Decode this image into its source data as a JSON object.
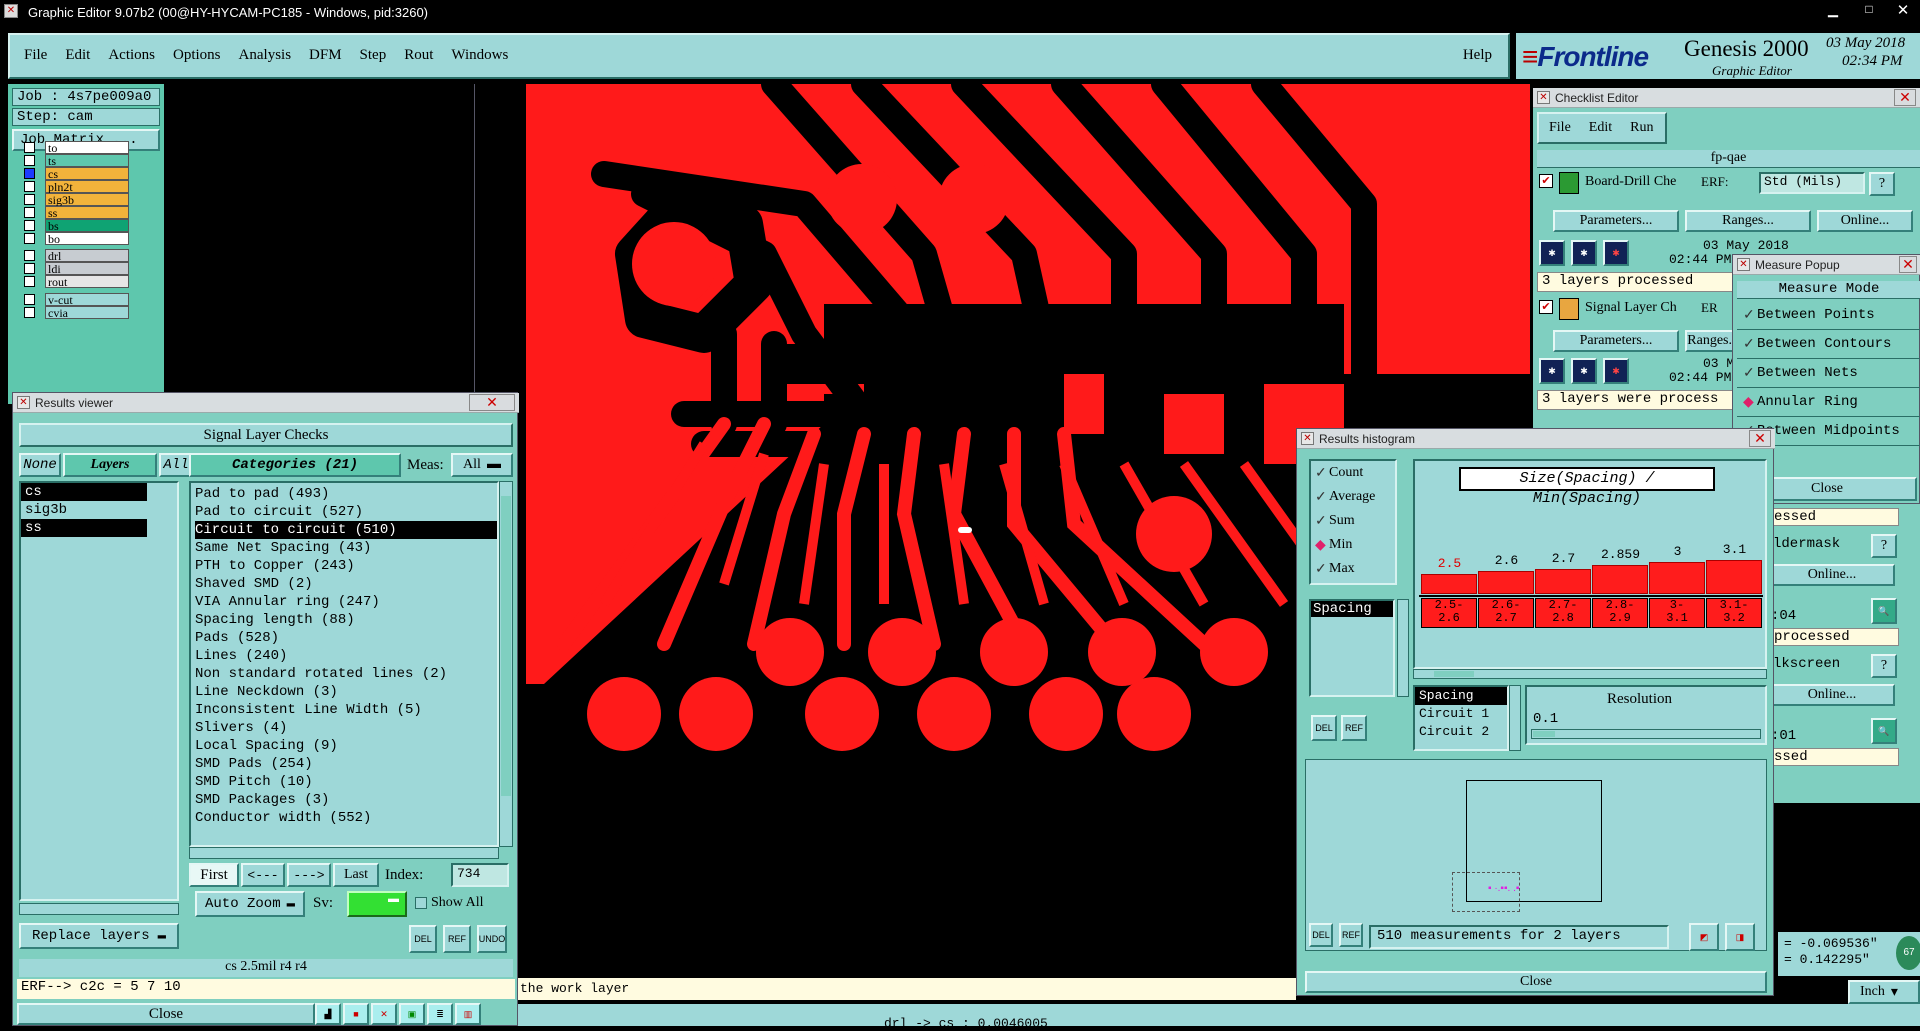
{
  "window": {
    "title": "Graphic Editor 9.07b2 (00@HY-HYCAM-PC185 - Windows, pid:3260)"
  },
  "menu": [
    "File",
    "Edit",
    "Actions",
    "Options",
    "Analysis",
    "DFM",
    "Step",
    "Rout",
    "Windows"
  ],
  "help": "Help",
  "brand": {
    "logo": "Frontline",
    "product": "Genesis 2000",
    "subtitle": "Graphic Editor",
    "date": "03 May 2018",
    "time": "02:34 PM"
  },
  "job": {
    "job": "Job : 4s7pe009a0",
    "step": "Step: cam",
    "matrix": "Job Matrix ..."
  },
  "layers": [
    {
      "name": "to",
      "color": "#ffffff"
    },
    {
      "name": "ts",
      "color": "#5ec7ad"
    },
    {
      "name": "cs",
      "color": "#f2b33b"
    },
    {
      "name": "pln2t",
      "color": "#f2b33b"
    },
    {
      "name": "sig3b",
      "color": "#f2b33b"
    },
    {
      "name": "ss",
      "color": "#f2b33b"
    },
    {
      "name": "bs",
      "color": "#0fa373"
    },
    {
      "name": "bo",
      "color": "#ffffff"
    },
    {
      "name": "drl",
      "color": "#c7ccd1"
    },
    {
      "name": "ldi",
      "color": "#c7ccd1"
    },
    {
      "name": "rout",
      "color": "#e6e6e6"
    },
    {
      "name": "v-cut",
      "color": "#9ed8d8"
    },
    {
      "name": "cvia",
      "color": "#9ed8d8"
    }
  ],
  "results": {
    "title": "Results viewer",
    "header": "Signal Layer Checks",
    "none": "None",
    "layers_btn": "Layers",
    "all": "All",
    "layer_list": [
      "cs",
      "sig3b",
      "ss"
    ],
    "categories_btn": "Categories (21)",
    "meas_label": "Meas:",
    "meas_value": "All",
    "categories": [
      "Pad to pad (493)",
      "Pad to circuit (527)",
      "Circuit to circuit (510)",
      "Same Net Spacing (43)",
      "PTH to Copper (243)",
      "Shaved SMD (2)",
      "VIA Annular ring (247)",
      "Spacing length (88)",
      "Pads (528)",
      "Lines (240)",
      "Non standard rotated lines (2)",
      "Line Neckdown (3)",
      "Inconsistent Line Width (5)",
      "Slivers (4)",
      "Local Spacing (9)",
      "SMD Pads (254)",
      "SMD Pitch (10)",
      "SMD Packages (3)",
      "Conductor width (552)"
    ],
    "first": "First",
    "prev": "<---",
    "next": "--->",
    "last": "Last",
    "index_label": "Index:",
    "index_value": "734",
    "autozoom": "Auto Zoom",
    "sv": "Sv:",
    "showall": "Show All",
    "replace": "Replace layers",
    "status": "cs 2.5mil  r4  r4",
    "erf": "ERF--> c2c = 5 7 10",
    "close": "Close",
    "del": "DEL",
    "ref": "REF",
    "undo": "UNDO"
  },
  "checklist": {
    "title": "Checklist Editor",
    "menu": [
      "File",
      "Edit",
      "Run"
    ],
    "name": "fp-qae",
    "row1": {
      "name": "Board-Drill Che",
      "erf": "ERF:",
      "std": "Std (Mils)",
      "date": "03 May 2018",
      "time": "02:44 PM",
      "status": "3 layers processed"
    },
    "row2": {
      "name": "Signal Layer Ch",
      "erf": "ER",
      "date": "03 May",
      "time": "02:44 PM",
      "status": "3 layers were process"
    },
    "params": "Parameters...",
    "ranges": "Ranges...",
    "online": "Online...",
    "q": "?",
    "frag": [
      "essed",
      "ldermask",
      "Online...",
      ":04",
      "processed",
      "lkscreen",
      "Online...",
      ":01",
      "ssed"
    ]
  },
  "measure": {
    "title": "Measure Popup",
    "header": "Measure Mode",
    "modes": [
      "Between Points",
      "Between Contours",
      "Between Nets",
      "Annular Ring",
      "Between Midpoints"
    ],
    "close": "Close"
  },
  "histogram": {
    "title": "Results histogram",
    "stats": [
      "Count",
      "Average",
      "Sum",
      "Min",
      "Max"
    ],
    "selected_stat": "Min",
    "spacing": "Spacing",
    "chart_title": "Size(Spacing) / Min(Spacing)",
    "list": [
      "Spacing",
      "Circuit 1",
      "Circuit 2"
    ],
    "resolution_label": "Resolution",
    "resolution_value": "0.1",
    "status": "510 measurements for 2 layers",
    "close": "Close",
    "del": "DEL",
    "ref": "REF"
  },
  "chart_data": {
    "type": "bar",
    "title": "Size(Spacing) / Min(Spacing)",
    "categories": [
      "2.5-\n2.6",
      "2.6-\n2.7",
      "2.7-\n2.8",
      "2.8-\n2.9",
      "3-\n3.1",
      "3.1-\n3.2"
    ],
    "values": [
      2.5,
      2.6,
      2.7,
      2.859,
      3,
      3.1
    ],
    "value_labels": [
      "2.5",
      "2.6",
      "2.7",
      "2.859",
      "3",
      "3.1"
    ],
    "highlight_color": "#e00000"
  },
  "status": {
    "hint": "the work layer",
    "coord": "drl -> cs : 0.0046005",
    "x": "= -0.069536\"",
    "y": "= 0.142295\"",
    "units": "Inch"
  },
  "colors": {
    "copper": "#ff1a1a",
    "panel": "#5ec7ad",
    "light": "#9ed8d8"
  }
}
